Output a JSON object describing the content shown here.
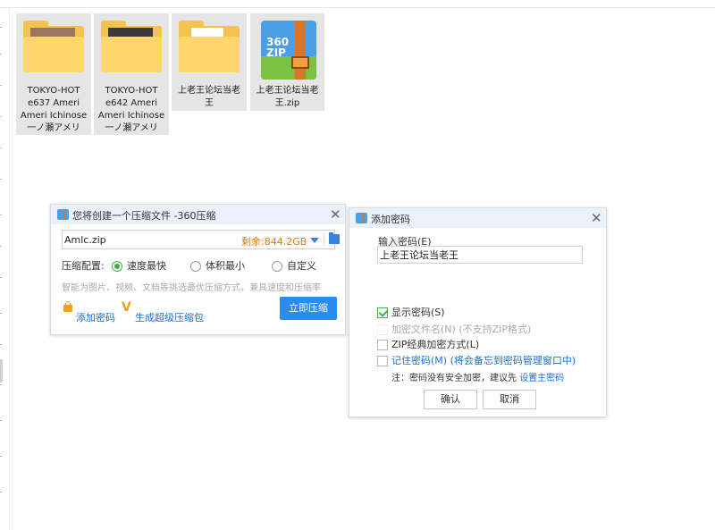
{
  "files": [
    {
      "name": "TOKYO-HOT\ne637 Ameri\nAmeri Ichinose\n一ノ瀬アメリ",
      "type": "folder"
    },
    {
      "name": "TOKYO-HOT\ne642 Ameri\nAmeri Ichinose\n一ノ瀬アメリ",
      "type": "folder"
    },
    {
      "name": "上老王论坛当老\n王",
      "type": "folder"
    },
    {
      "name": "上老王论坛当老\n王.zip",
      "type": "zip",
      "icon_text": "360\nZIP"
    }
  ],
  "compress_dialog": {
    "title": "您将创建一个压缩文件 -360压缩",
    "filename": "Amlc.zip",
    "free_space": "剩余:844.2GB",
    "config_label": "压缩配置:",
    "options": [
      "速度最快",
      "体积最小",
      "自定义"
    ],
    "selected_option": "速度最快",
    "hint": "智能为图片、视频、文档等挑选最优压缩方式，兼具速度和压缩率",
    "add_password": "添加密码",
    "super_zip": "生成超级压缩包",
    "compress_now": "立即压缩"
  },
  "password_dialog": {
    "title": "添加密码",
    "input_label": "输入密码(E)",
    "password_value": "上老王论坛当老王",
    "show_password": {
      "label": "显示密码(S)",
      "checked": true
    },
    "encrypt_filename": {
      "label": "加密文件名(N) (不支持ZIP格式)",
      "checked": false,
      "disabled": true
    },
    "zip_classic": {
      "label": "ZIP经典加密方式(L)",
      "checked": false
    },
    "remember_password": {
      "label": "记住密码(M)",
      "extra": "(将会备忘到密码管理窗口中)",
      "checked": false
    },
    "note_prefix": "注：密码没有安全加密，建议先 ",
    "note_link": "设置主密码",
    "ok": "确认",
    "cancel": "取消"
  },
  "colors": {
    "accent": "#2b8cf0",
    "check": "#3fae49",
    "free_space": "#e07a10",
    "title_bar": "#eaf1fb"
  }
}
